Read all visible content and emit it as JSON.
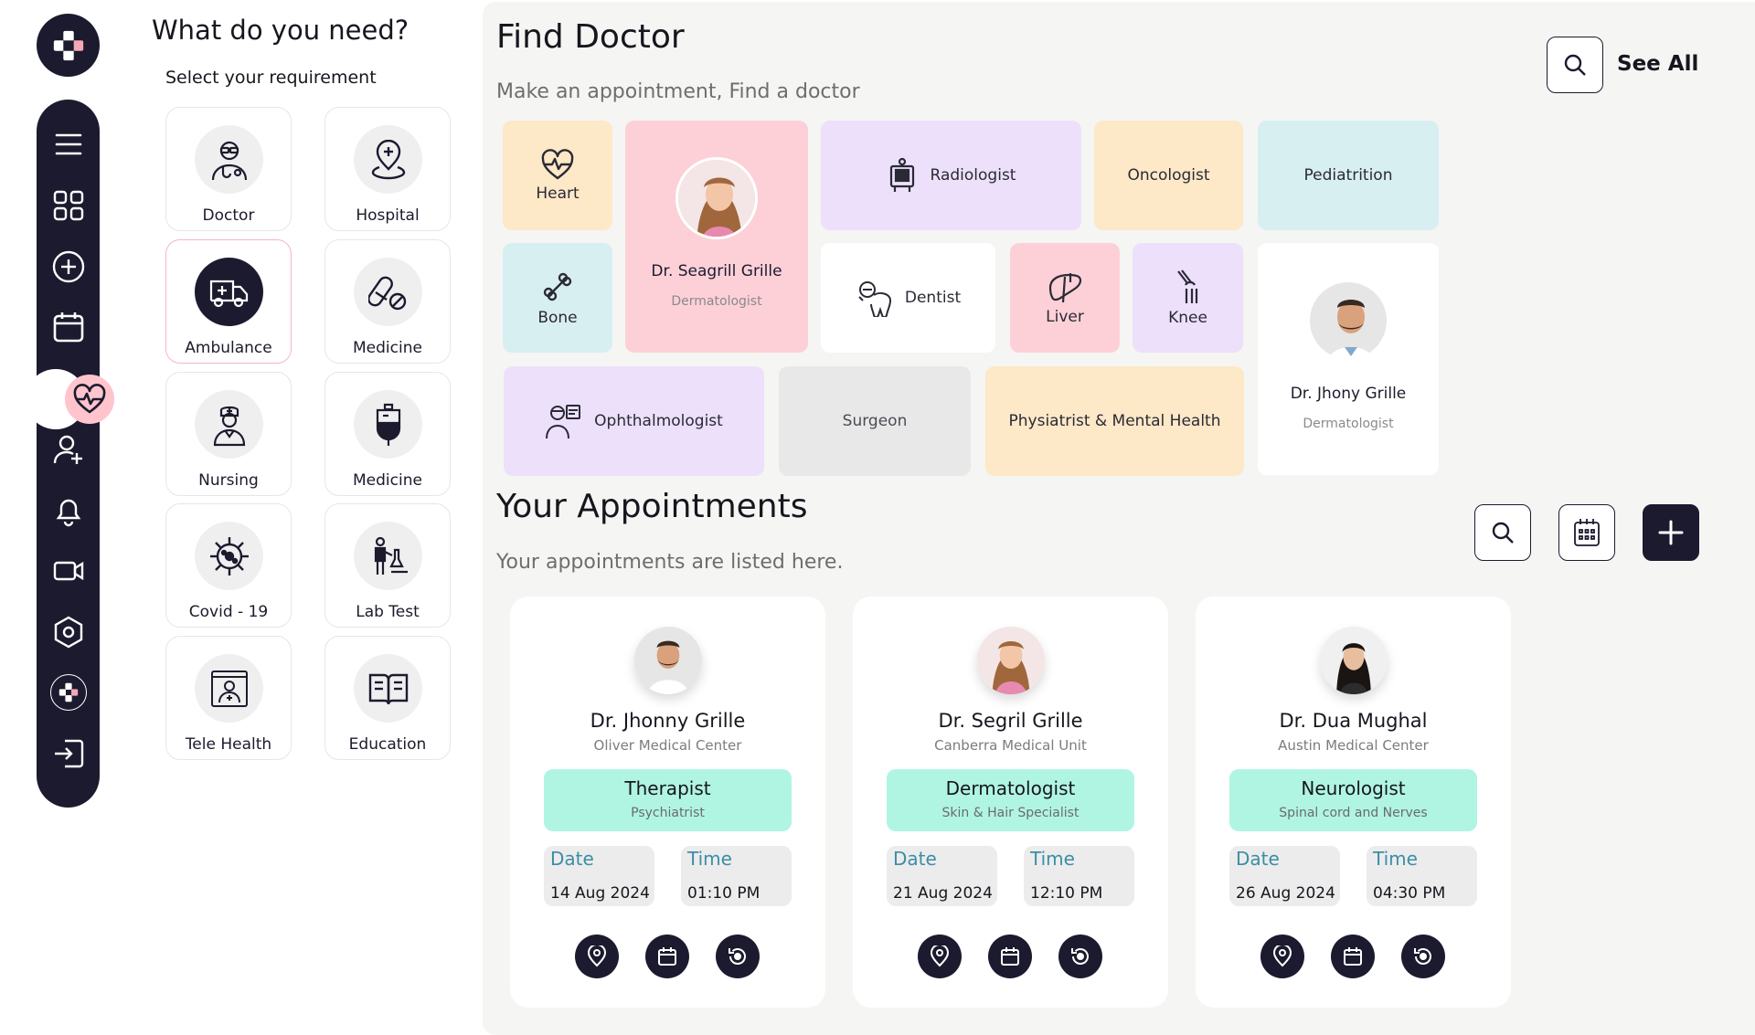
{
  "sidebar": {
    "logo_icon": "brand-cross-icon",
    "items": [
      {
        "name": "menu",
        "icon": "hamburger-icon"
      },
      {
        "name": "dashboard",
        "icon": "grid-icon"
      },
      {
        "name": "add",
        "icon": "plus-circle-icon"
      },
      {
        "name": "calendar",
        "icon": "calendar-icon"
      },
      {
        "name": "health",
        "icon": "heartbeat-icon",
        "active": true
      },
      {
        "name": "profile",
        "icon": "user-plus-icon"
      },
      {
        "name": "notifications",
        "icon": "bell-icon"
      },
      {
        "name": "video",
        "icon": "video-icon"
      },
      {
        "name": "settings",
        "icon": "hexagon-settings-icon"
      },
      {
        "name": "brand",
        "icon": "brand-cross-icon"
      },
      {
        "name": "logout",
        "icon": "logout-icon"
      }
    ],
    "active_color": "#ffc4cc",
    "bg_color": "#1c1a2e"
  },
  "requirements": {
    "title": "What do you need?",
    "subtitle": "Select your requirement",
    "items": [
      {
        "label": "Doctor",
        "icon": "doctor-icon"
      },
      {
        "label": "Hospital",
        "icon": "hospital-pin-icon"
      },
      {
        "label": "Ambulance",
        "icon": "ambulance-icon",
        "active": true
      },
      {
        "label": "Medicine",
        "icon": "pill-icon"
      },
      {
        "label": "Nursing",
        "icon": "nurse-icon"
      },
      {
        "label": "Medicine",
        "icon": "iv-bag-icon"
      },
      {
        "label": "Covid - 19",
        "icon": "virus-icon"
      },
      {
        "label": "Lab Test",
        "icon": "lab-test-icon"
      },
      {
        "label": "Tele Health",
        "icon": "tele-health-icon"
      },
      {
        "label": "Education",
        "icon": "book-icon"
      }
    ]
  },
  "find_doctor": {
    "title": "Find Doctor",
    "subtitle": "Make an appointment, Find a doctor",
    "see_all": "See All",
    "categories": {
      "heart": "Heart",
      "bone": "Bone",
      "radiologist": "Radiologist",
      "oncologist": "Oncologist",
      "pediatrition": "Pediatrition",
      "dentist": "Dentist",
      "liver": "Liver",
      "knee": "Knee",
      "ophthalmologist": "Ophthalmologist",
      "surgeon": "Surgeon",
      "physiatrist": "Physiatrist & Mental Health"
    },
    "featured": [
      {
        "name": "Dr. Seagrill Grille",
        "specialty": "Dermatologist"
      },
      {
        "name": "Dr. Jhony Grille",
        "specialty": "Dermatologist"
      }
    ],
    "colors": {
      "peach": "#fde8c8",
      "pink": "#fdd0d8",
      "lavender": "#ede0fb",
      "cyan": "#d8eff2",
      "grey": "#e8e8e8"
    }
  },
  "appointments": {
    "title": "Your Appointments",
    "subtitle": "Your appointments are listed here.",
    "date_label": "Date",
    "time_label": "Time",
    "items": [
      {
        "doctor": "Dr. Jhonny Grille",
        "center": "Oliver Medical Center",
        "specialty": "Therapist",
        "sub_specialty": "Psychiatrist",
        "date": "14 Aug 2024",
        "time": "01:10 PM"
      },
      {
        "doctor": "Dr. Segril Grille",
        "center": "Canberra Medical Unit",
        "specialty": "Dermatologist",
        "sub_specialty": "Skin & Hair Specialist",
        "date": "21 Aug 2024",
        "time": "12:10 PM"
      },
      {
        "doctor": "Dr. Dua Mughal",
        "center": "Austin Medical Center",
        "specialty": "Neurologist",
        "sub_specialty": "Spinal cord and Nerves",
        "date": "26 Aug 2024",
        "time": "04:30 PM"
      }
    ],
    "accent": "#b0f5e2"
  }
}
